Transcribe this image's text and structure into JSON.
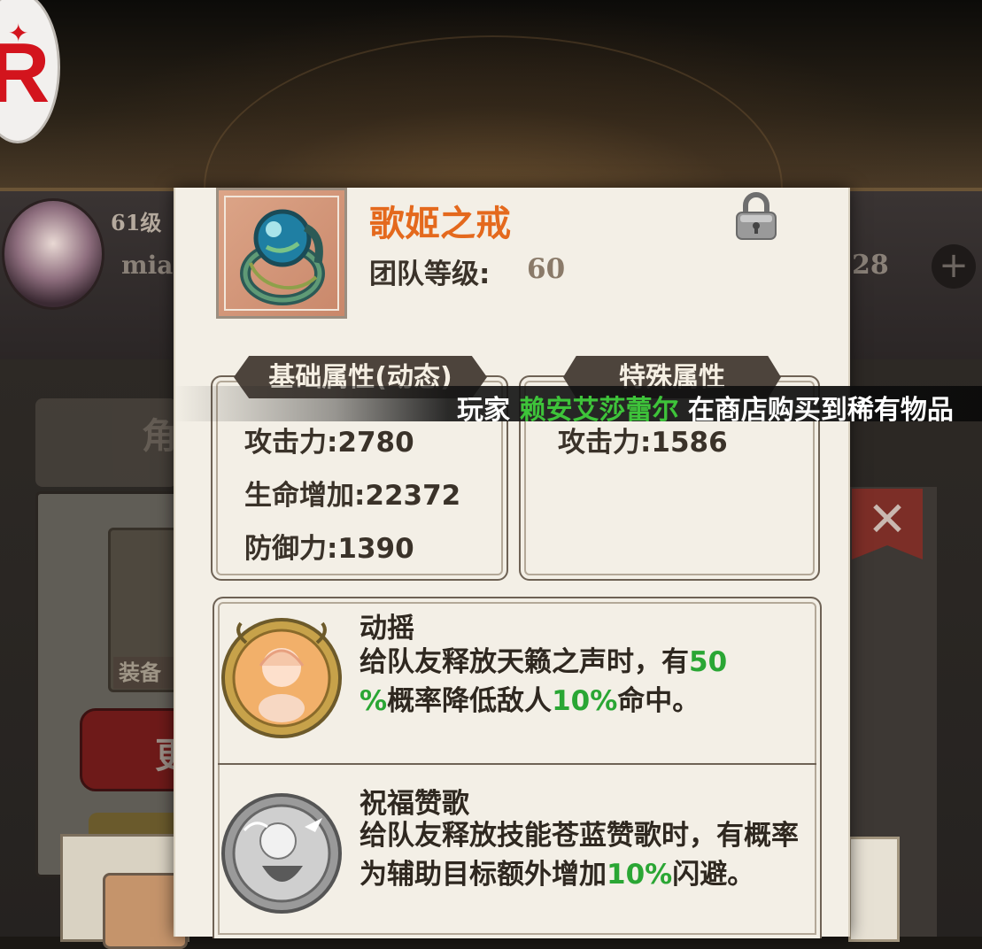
{
  "logo": {
    "letter": "R"
  },
  "background": {
    "level": "61级",
    "name": "mia",
    "number": "28",
    "plus": "+",
    "tab_glyph": "角",
    "equip_label": "装备",
    "red_button_glyph": "更",
    "close_glyph": "✕"
  },
  "item": {
    "name": "歌姬之戒",
    "team_level_label": "团队等级:",
    "team_level_value": "60",
    "icon": "ring-icon",
    "locked_icon": "lock-icon"
  },
  "basic_stats": {
    "title": "基础属性(动态)",
    "lines": [
      "攻击力:2780",
      "生命增加:22372",
      "防御力:1390"
    ]
  },
  "special_stats": {
    "title": "特殊属性",
    "lines": [
      "攻击力:1586"
    ]
  },
  "skills": [
    {
      "name": "动摇",
      "desc_parts": [
        "给队友释放天籁之声时，有",
        "50",
        "%",
        "概率降低敌人",
        "10%",
        "命中。"
      ],
      "icon": "singer-emblem-icon"
    },
    {
      "name": "祝福赞歌",
      "desc_parts": [
        "给队友释放技能苍蓝赞歌时，有概率为辅助目标额外增加",
        "10%",
        "闪避。"
      ],
      "icon": "blessing-emblem-icon"
    }
  ],
  "marquee": {
    "prefix": "玩家 ",
    "player": "赖安艾莎蕾尔",
    "suffix": " 在商店购买到稀有物品"
  },
  "colors": {
    "item_name": "#e4691d",
    "highlight_green": "#2aa634",
    "marquee_player": "#3ec43a"
  }
}
